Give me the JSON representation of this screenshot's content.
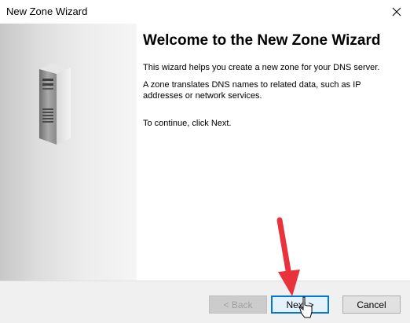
{
  "window": {
    "title": "New Zone Wizard"
  },
  "icons": {
    "close": "close-icon",
    "server": "server-icon",
    "arrow": "red-arrow-annotation",
    "cursor": "mouse-pointer-icon"
  },
  "content": {
    "heading": "Welcome to the New Zone Wizard",
    "para1": "This wizard helps you create a new zone for your DNS server.",
    "para2": "A zone translates DNS names to related data, such as IP addresses or network services.",
    "para3": "To continue, click Next."
  },
  "buttons": {
    "back": "< Back",
    "next": "Next >",
    "cancel": "Cancel"
  },
  "colors": {
    "annotation_arrow": "#e8323c",
    "focus_border": "#0078d7"
  }
}
